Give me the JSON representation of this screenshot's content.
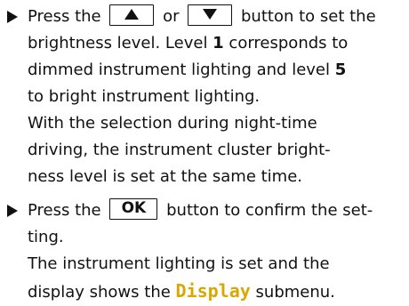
{
  "step1": {
    "t1": "Press the",
    "t2": "or",
    "t3": "button to set the",
    "line2": "brightness level. Level ",
    "level_low": "1",
    "line2b": " corresponds to",
    "line3": "dimmed instrument lighting and level ",
    "level_high": "5",
    "line4": "to bright instrument lighting.",
    "line5": "With the selection during night-time",
    "line6": "driving, the instrument cluster bright-",
    "line7": "ness level is set at the same time."
  },
  "step2": {
    "t1": "Press the",
    "ok_label": "OK",
    "t2": "button to confirm the set-",
    "line2": "ting.",
    "line3": "The instrument lighting is set and the",
    "line4a": "display shows the ",
    "display_word": "Display",
    "line4b": " submenu."
  },
  "icons": {
    "bullet": "triangle-right-bullet",
    "up": "up-arrow-key",
    "down": "down-arrow-key"
  },
  "colors": {
    "display_word": "#d8a800",
    "text": "#111111"
  }
}
